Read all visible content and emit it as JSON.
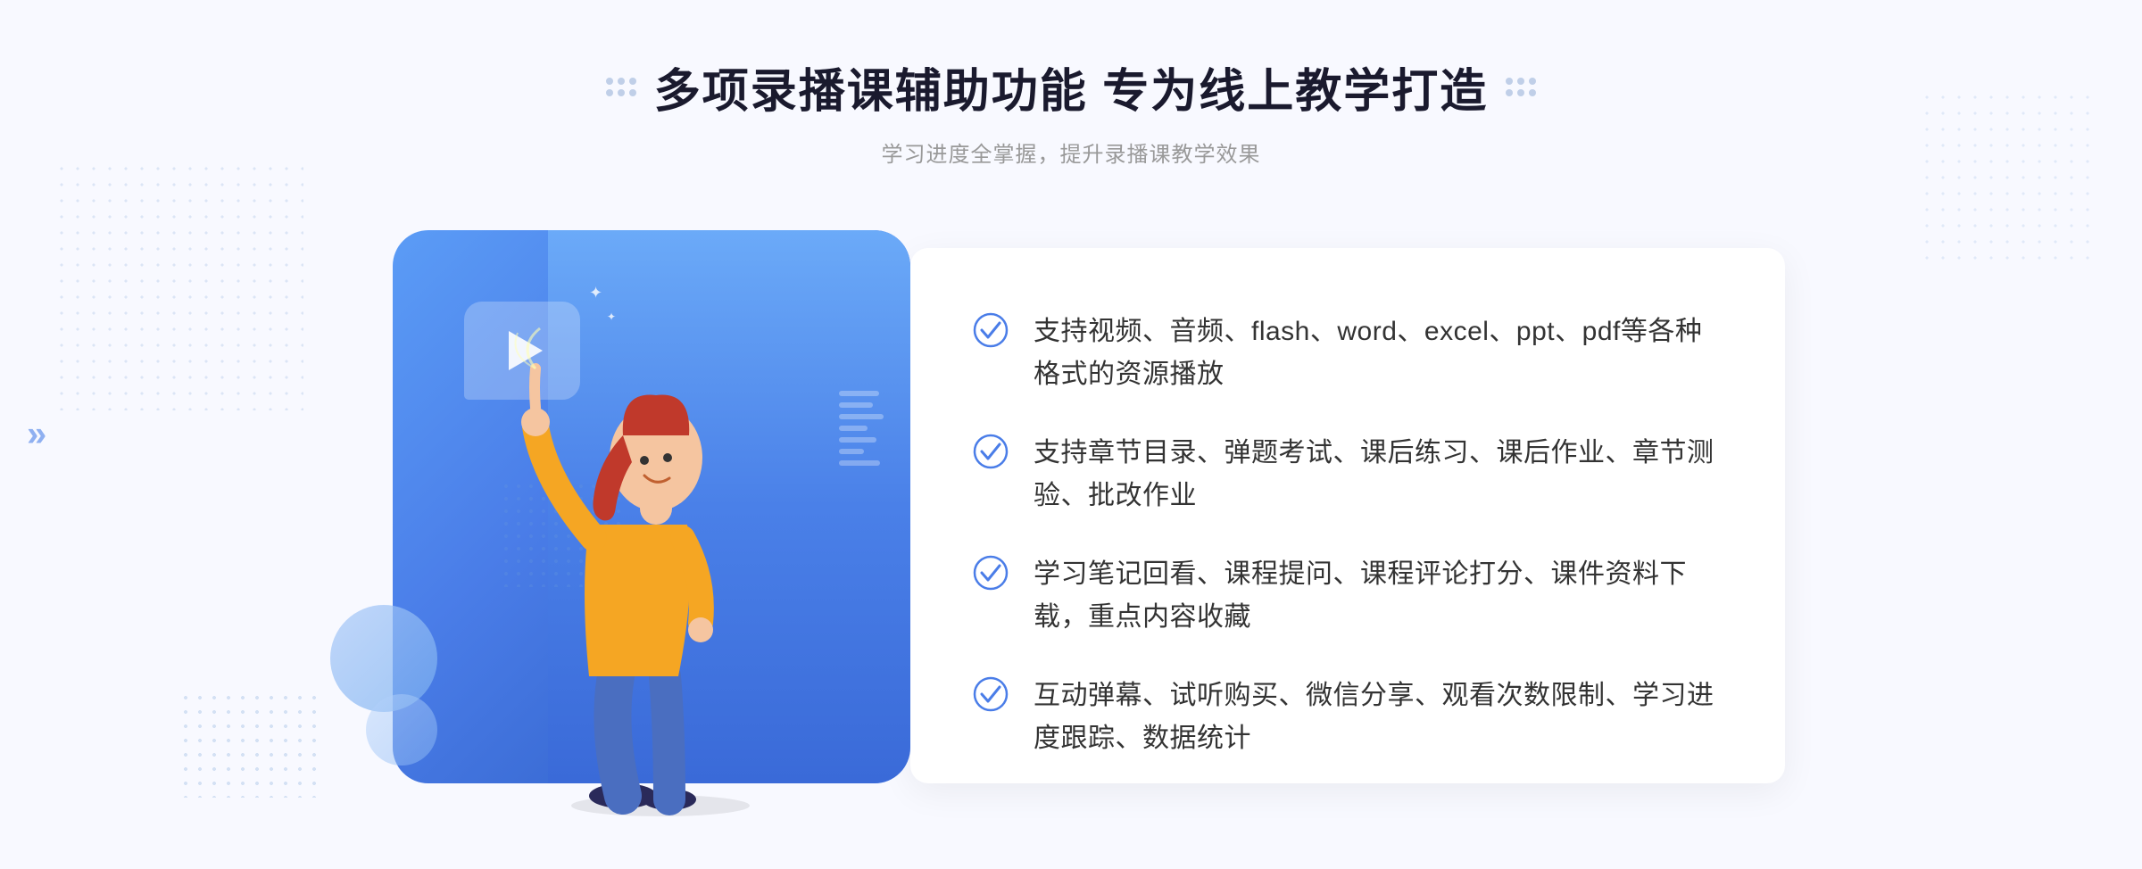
{
  "header": {
    "title": "多项录播课辅助功能 专为线上教学打造",
    "subtitle": "学习进度全掌握，提升录播课教学效果",
    "title_dots_label": "decorative dots"
  },
  "features": [
    {
      "id": 1,
      "text": "支持视频、音频、flash、word、excel、ppt、pdf等各种格式的资源播放"
    },
    {
      "id": 2,
      "text": "支持章节目录、弹题考试、课后练习、课后作业、章节测验、批改作业"
    },
    {
      "id": 3,
      "text": "学习笔记回看、课程提问、课程评论打分、课件资料下载，重点内容收藏"
    },
    {
      "id": 4,
      "text": "互动弹幕、试听购买、微信分享、观看次数限制、学习进度跟踪、数据统计"
    }
  ],
  "colors": {
    "primary": "#4a7de8",
    "primary_light": "#6baaf8",
    "check_color": "#4a7de8",
    "text_dark": "#1a1a2e",
    "text_gray": "#999999",
    "text_feature": "#333333"
  },
  "icons": {
    "play": "▶",
    "check": "✓",
    "chevron_left": "»",
    "sparkle": "✦"
  }
}
